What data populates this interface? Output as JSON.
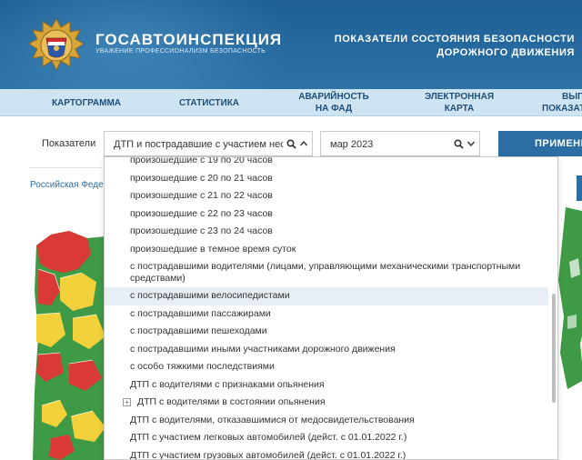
{
  "header": {
    "brand_title": "ГОСАВТОИНСПЕКЦИЯ",
    "brand_sub": "УВАЖЕНИЕ ПРОФЕССИОНАЛИЗМ БЕЗОПАСНОСТЬ",
    "right_line1": "ПОКАЗАТЕЛИ СОСТОЯНИЯ БЕЗОПАСНОСТИ",
    "right_line2": "ДОРОЖНОГО ДВИЖЕНИЯ"
  },
  "nav": {
    "items": [
      {
        "label": "КАРТОГРАММА"
      },
      {
        "label": "СТАТИСТИКА"
      },
      {
        "label1": "АВАРИЙНОСТЬ",
        "label2": "НА ФАД"
      },
      {
        "label1": "ЭЛЕКТРОННАЯ",
        "label2": "КАРТА"
      },
      {
        "label1": "ВЫГР",
        "label2": "ПОКАЗАТ"
      }
    ]
  },
  "filters": {
    "label": "Показатели",
    "indicator_value": "ДТП и пострадавшие с участием несовершеннолетних",
    "period_value": "мар 2023",
    "apply_label": "ПРИМЕНИТЬ"
  },
  "breadcrumb": "Российская Федерация",
  "dropdown": {
    "items": [
      {
        "label": "произошедшие с 19 по 20 часов"
      },
      {
        "label": "произошедшие с 20 по 21 часов"
      },
      {
        "label": "произошедшие с 21 по 22 часов"
      },
      {
        "label": "произошедшие с 22 по 23 часов"
      },
      {
        "label": "произошедшие с 23 по 24 часов"
      },
      {
        "label": "произошедшие в темное время суток"
      },
      {
        "label": "с пострадавшими водителями (лицами, управляющими механическими транспортными средствами)"
      },
      {
        "label": "с пострадавшими велосипедистами"
      },
      {
        "label": "с пострадавшими пассажирами"
      },
      {
        "label": "с пострадавшими пешеходами"
      },
      {
        "label": "с пострадавшими иными участниками дорожного движения"
      },
      {
        "label": "с особо тяжкими последствиями"
      },
      {
        "label": "ДТП с водителями с признаками опьянения"
      },
      {
        "label": "ДТП с водителями в состоянии опьянения"
      },
      {
        "label": "ДТП с водителями, отказавшимися от медосвидетельствования"
      },
      {
        "label": "ДТП с участием легковых автомобилей (дейст. с 01.01.2022 г.)"
      },
      {
        "label": "ДТП с участием грузовых автомобилей (дейст. с 01.01.2022 г.)"
      }
    ],
    "highlighted_index": 7,
    "expandable_index": 13
  },
  "colors": {
    "header_bg": "#2b72a8",
    "nav_bg": "#cfe4f2",
    "accent": "#2c6ea3",
    "map_red": "#d93a36",
    "map_yellow": "#f2d13b",
    "map_green": "#3e9a45"
  },
  "icons": {
    "search": "search-icon",
    "chevron_up": "chevron-up-icon",
    "chevron_down": "chevron-down-icon",
    "expand": "plus-box-icon"
  }
}
